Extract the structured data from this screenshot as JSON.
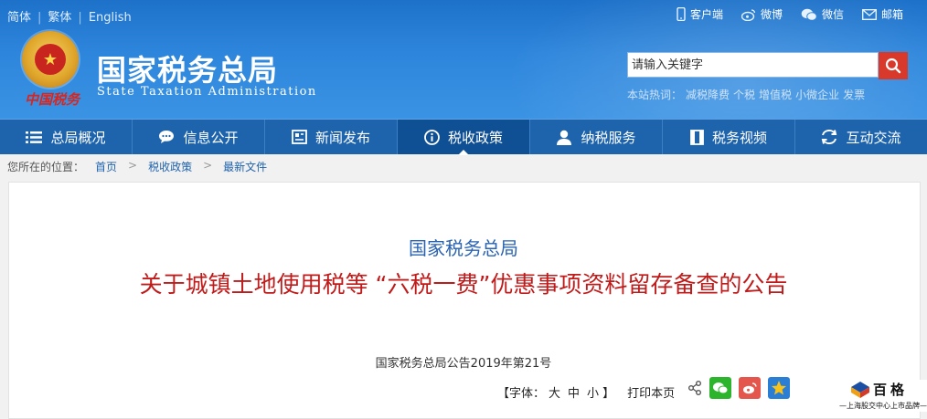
{
  "lang": {
    "items": [
      "简体",
      "繁体",
      "English"
    ]
  },
  "toplinks": [
    {
      "icon": "mobile-icon",
      "label": "客户端"
    },
    {
      "icon": "weibo-icon",
      "label": "微博"
    },
    {
      "icon": "wechat-icon",
      "label": "微信"
    },
    {
      "icon": "mail-icon",
      "label": "邮箱"
    }
  ],
  "brand": {
    "emblem_text": "中国税务",
    "title": "国家税务总局",
    "subtitle": "State Taxation Administration"
  },
  "search": {
    "placeholder": "请输入关键字",
    "hot_label": "本站热词：",
    "hot_words": [
      "减税降费",
      "个税",
      "增值税",
      "小微企业",
      "发票"
    ]
  },
  "nav": [
    {
      "icon": "menu-icon",
      "label": "总局概况",
      "active": false
    },
    {
      "icon": "chat-icon",
      "label": "信息公开",
      "active": false
    },
    {
      "icon": "news-icon",
      "label": "新闻发布",
      "active": false
    },
    {
      "icon": "info-icon",
      "label": "税收政策",
      "active": true
    },
    {
      "icon": "user-icon",
      "label": "纳税服务",
      "active": false
    },
    {
      "icon": "video-icon",
      "label": "税务视频",
      "active": false
    },
    {
      "icon": "exchange-icon",
      "label": "互动交流",
      "active": false
    }
  ],
  "breadcrumb": {
    "prefix": "您所在的位置：",
    "items": [
      "首页",
      "税收政策",
      "最新文件"
    ]
  },
  "article": {
    "org": "国家税务总局",
    "title": "关于城镇土地使用税等 “六税一费”优惠事项资料留存备查的公告",
    "doc_no": "国家税务总局公告2019年第21号"
  },
  "tools": {
    "font_label": "【字体：",
    "sizes": [
      "大",
      "中",
      "小"
    ],
    "font_close": "】",
    "print": "打印本页"
  },
  "share": [
    "share-icon",
    "wechat-share-icon",
    "weibo-share-icon",
    "qzone-share-icon"
  ],
  "watermark": {
    "name": "百格",
    "sub": "—上海股交中心上市品牌—"
  },
  "colors": {
    "header": "#2e86dc",
    "nav": "#1e64ad",
    "nav_active": "#0f4f94",
    "title_red": "#c01b1b",
    "org_blue": "#2a63b3"
  }
}
